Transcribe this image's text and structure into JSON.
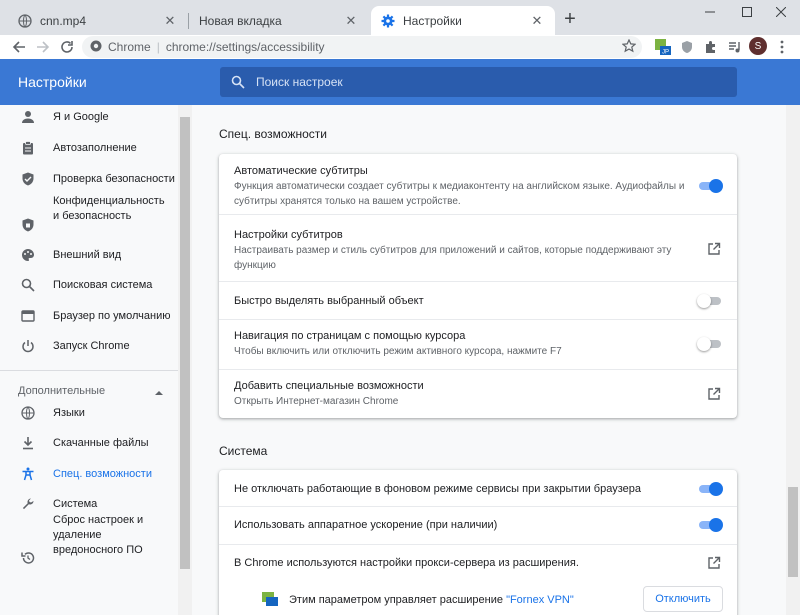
{
  "tabs": [
    {
      "title": "cnn.mp4",
      "active": false
    },
    {
      "title": "Новая вкладка",
      "active": false
    },
    {
      "title": "Настройки",
      "active": true
    }
  ],
  "toolbar": {
    "site": "Chrome",
    "url": "chrome://settings/accessibility",
    "avatar_letter": "S"
  },
  "header": {
    "title": "Настройки",
    "search_placeholder": "Поиск настроек"
  },
  "sidebar": {
    "items": [
      {
        "label": "Я и Google",
        "icon": "person-icon"
      },
      {
        "label": "Автозаполнение",
        "icon": "clipboard-icon"
      },
      {
        "label": "Проверка безопасности",
        "icon": "shield-check-icon"
      },
      {
        "label": "Конфиденциальность и безопасность",
        "icon": "shield-icon"
      },
      {
        "label": "Внешний вид",
        "icon": "palette-icon"
      },
      {
        "label": "Поисковая система",
        "icon": "search-icon"
      },
      {
        "label": "Браузер по умолчанию",
        "icon": "browser-icon"
      },
      {
        "label": "Запуск Chrome",
        "icon": "power-icon"
      }
    ],
    "advanced_label": "Дополнительные",
    "advanced_items": [
      {
        "label": "Языки",
        "icon": "globe-icon"
      },
      {
        "label": "Скачанные файлы",
        "icon": "download-icon"
      },
      {
        "label": "Спец. возможности",
        "icon": "accessibility-icon",
        "active": true
      },
      {
        "label": "Система",
        "icon": "wrench-icon"
      },
      {
        "label": "Сброс настроек и удаление вредоносного ПО",
        "icon": "restore-icon"
      }
    ]
  },
  "accessibility": {
    "title": "Спец. возможности",
    "rows": [
      {
        "title": "Автоматические субтитры",
        "sub": "Функция автоматически создает субтитры к медиаконтенту на английском языке. Аудиофайлы и субтитры хранятся только на вашем устройстве.",
        "control": "toggle",
        "on": true
      },
      {
        "title": "Настройки субтитров",
        "sub": "Настраивать размер и стиль субтитров для приложений и сайтов, которые поддерживают эту функцию",
        "control": "launch"
      },
      {
        "title": "Быстро выделять выбранный объект",
        "sub": "",
        "control": "toggle",
        "on": false
      },
      {
        "title": "Навигация по страницам с помощью курсора",
        "sub": "Чтобы включить или отключить режим активного курсора, нажмите F7",
        "control": "toggle",
        "on": false
      },
      {
        "title": "Добавить специальные возможности",
        "sub": "Открыть Интернет-магазин Chrome",
        "control": "launch"
      }
    ]
  },
  "system": {
    "title": "Система",
    "rows": [
      {
        "title": "Не отключать работающие в фоновом режиме сервисы при закрытии браузера",
        "control": "toggle",
        "on": true
      },
      {
        "title": "Использовать аппаратное ускорение (при наличии)",
        "control": "toggle",
        "on": true
      },
      {
        "title": "В Chrome используются настройки прокси-сервера из расширения.",
        "control": "launch"
      }
    ],
    "extension_notice_prefix": "Этим параметром управляет расширение ",
    "extension_name": "\"Fornex VPN\"",
    "disable_button": "Отключить"
  },
  "colors": {
    "header_blue": "#3a78d4",
    "accent": "#1a73e8"
  }
}
